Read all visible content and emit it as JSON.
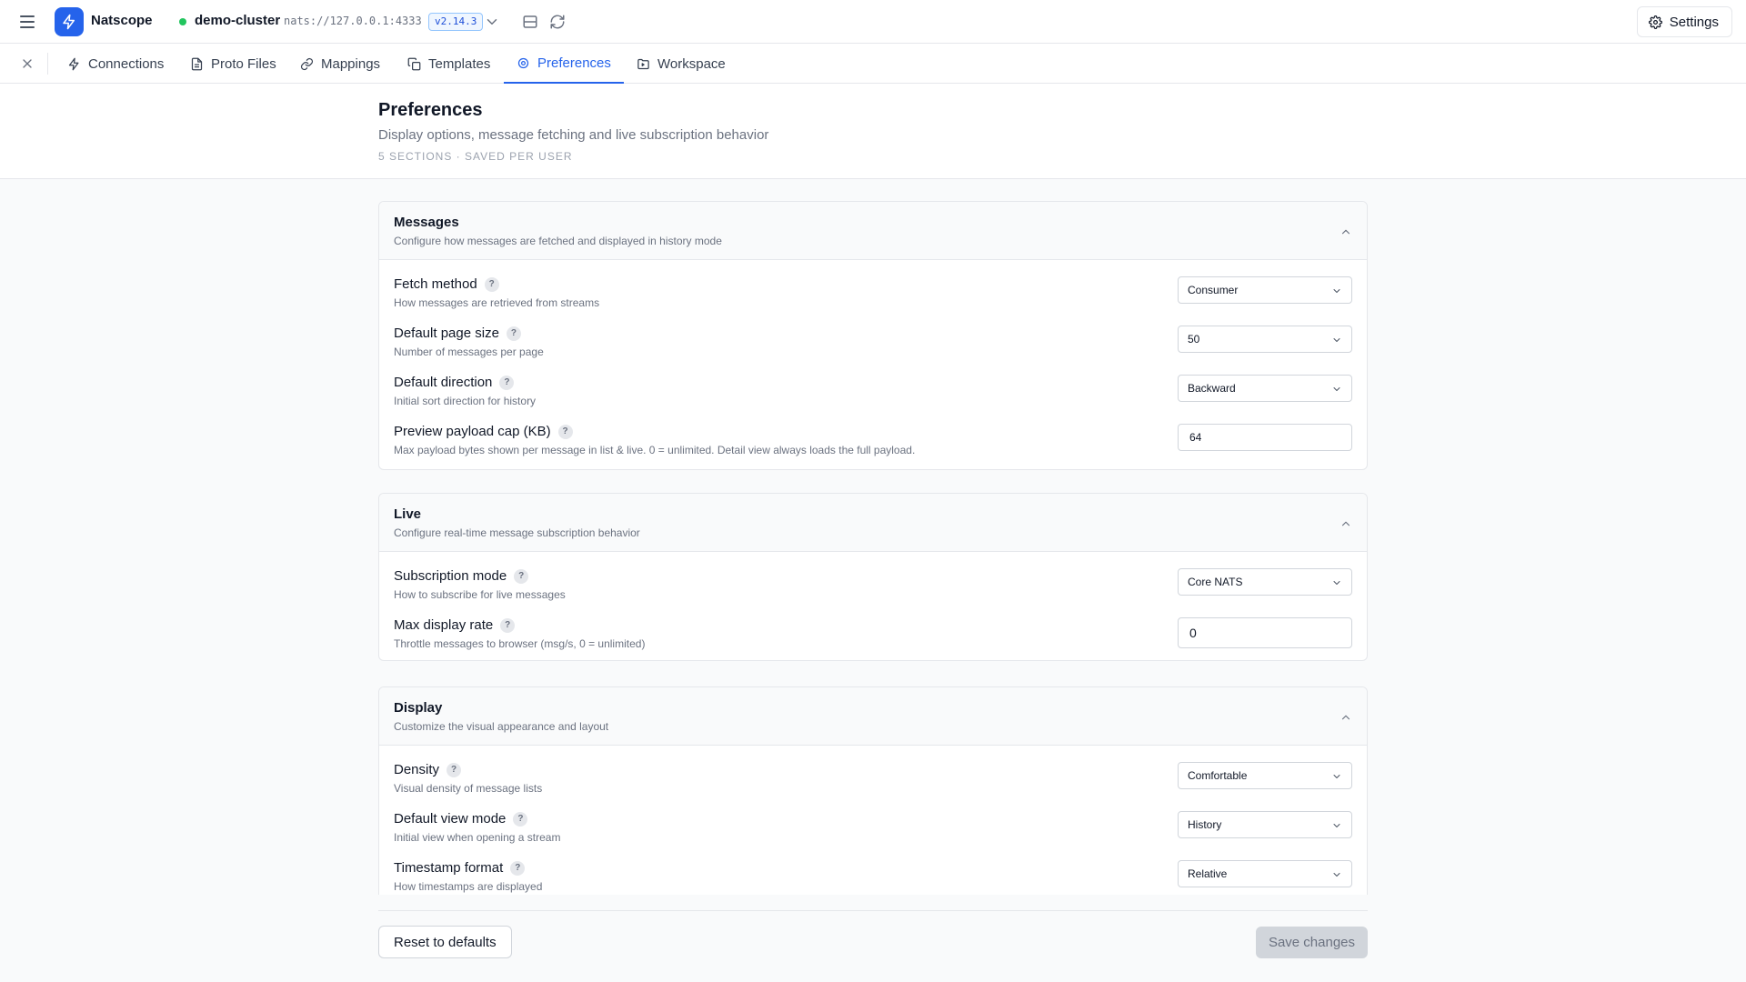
{
  "app": {
    "name": "Natscope"
  },
  "cluster": {
    "name": "demo-cluster",
    "url": "nats://127.0.0.1:4333",
    "version": "v2.14.3",
    "status_color": "#22c55e"
  },
  "header": {
    "settings_label": "Settings"
  },
  "tabs": [
    {
      "label": "Connections",
      "icon": "bolt-icon"
    },
    {
      "label": "Proto Files",
      "icon": "file-icon"
    },
    {
      "label": "Mappings",
      "icon": "link-icon"
    },
    {
      "label": "Templates",
      "icon": "copy-icon"
    },
    {
      "label": "Preferences",
      "icon": "gear-icon",
      "active": true
    },
    {
      "label": "Workspace",
      "icon": "folder-icon"
    }
  ],
  "page": {
    "title": "Preferences",
    "subtitle": "Display options, message fetching and live subscription behavior",
    "meta": "5 SECTIONS · SAVED PER USER"
  },
  "sections": {
    "messages": {
      "title": "Messages",
      "description": "Configure how messages are fetched and displayed in history mode",
      "rows": {
        "fetch_method": {
          "label": "Fetch method",
          "description": "How messages are retrieved from streams",
          "value": "Consumer"
        },
        "page_size": {
          "label": "Default page size",
          "description": "Number of messages per page",
          "value": "50"
        },
        "direction": {
          "label": "Default direction",
          "description": "Initial sort direction for history",
          "value": "Backward"
        },
        "payload_cap": {
          "label": "Preview payload cap (KB)",
          "description": "Max payload bytes shown per message in list & live. 0 = unlimited. Detail view always loads the full payload.",
          "value": "64"
        }
      }
    },
    "live": {
      "title": "Live",
      "description": "Configure real-time message subscription behavior",
      "rows": {
        "subscription_mode": {
          "label": "Subscription mode",
          "description": "How to subscribe for live messages",
          "value": "Core NATS"
        },
        "max_rate": {
          "label": "Max display rate",
          "description": "Throttle messages to browser (msg/s, 0 = unlimited)",
          "value": "0"
        }
      }
    },
    "display": {
      "title": "Display",
      "description": "Customize the visual appearance and layout",
      "rows": {
        "density": {
          "label": "Density",
          "description": "Visual density of message lists",
          "value": "Comfortable"
        },
        "view_mode": {
          "label": "Default view mode",
          "description": "Initial view when opening a stream",
          "value": "History"
        },
        "timestamp_format": {
          "label": "Timestamp format",
          "description": "How timestamps are displayed",
          "value": "Relative"
        }
      }
    }
  },
  "help_glyph": "?",
  "footer": {
    "reset_label": "Reset to defaults",
    "save_label": "Save changes"
  },
  "colors": {
    "accent": "#2563eb",
    "text": "#111827",
    "muted": "#6b7280",
    "border": "#e5e7eb"
  }
}
